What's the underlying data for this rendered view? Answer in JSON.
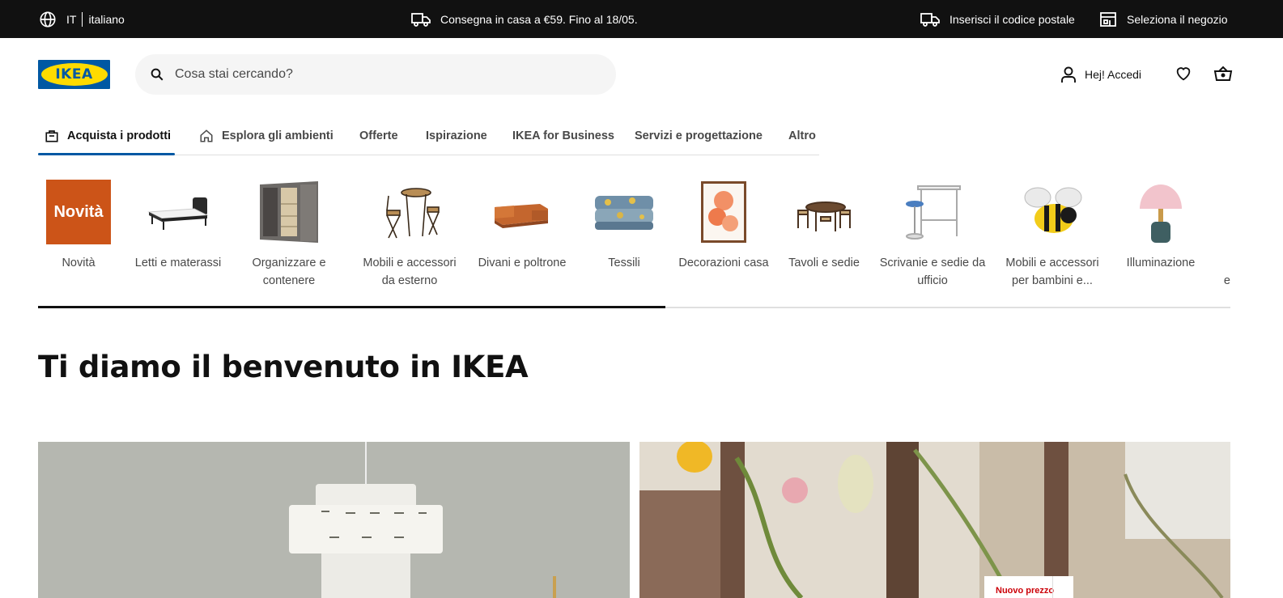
{
  "topbar": {
    "lang_code": "IT",
    "lang_name": "italiano",
    "promo": "Consegna in casa a €59. Fino al 18/05.",
    "zip": "Inserisci il codice postale",
    "store": "Seleziona il negozio"
  },
  "header": {
    "logo": "IKEA",
    "search_placeholder": "Cosa stai cercando?",
    "account": "Hej! Accedi"
  },
  "nav": {
    "tabs": [
      {
        "label": "Acquista i prodotti",
        "active": true
      },
      {
        "label": "Esplora gli ambienti"
      },
      {
        "label": "Offerte"
      },
      {
        "label": "Ispirazione"
      },
      {
        "label": "IKEA for Business"
      },
      {
        "label": "Servizi e progettazione"
      },
      {
        "label": "Altro"
      }
    ]
  },
  "categories": [
    {
      "label": "Novità",
      "tile": "Novità"
    },
    {
      "label": "Letti e materassi"
    },
    {
      "label": "Organizzare e contenere"
    },
    {
      "label": "Mobili e accessori da esterno"
    },
    {
      "label": "Divani e poltrone"
    },
    {
      "label": "Tessili"
    },
    {
      "label": "Decorazioni casa"
    },
    {
      "label": "Tavoli e sedie"
    },
    {
      "label": "Scrivanie e sedie da ufficio"
    },
    {
      "label": "Mobili e accessori per bambini e..."
    },
    {
      "label": "Illuminazione"
    },
    {
      "label": "e"
    }
  ],
  "carousel_progress": 0.526,
  "welcome": "Ti diamo il benvenuto in IKEA",
  "hero": {
    "badge": "Nuovo prezzo"
  },
  "colors": {
    "brand_blue": "#0058a3",
    "brand_yellow": "#ffdb00",
    "novita_orange": "#cc5418",
    "top_bar": "#111111"
  }
}
